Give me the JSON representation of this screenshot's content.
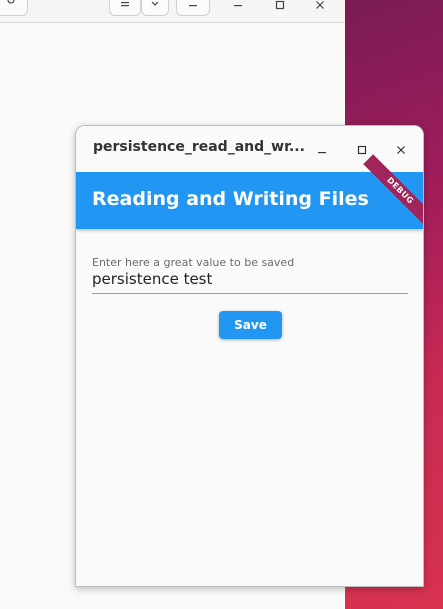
{
  "background_window": {
    "toolbar_icons": [
      "search-icon",
      "list-view-icon",
      "chevron-down-icon",
      "minimize-icon",
      "maximize-icon",
      "close-icon"
    ]
  },
  "app_window": {
    "title": "persistence_read_and_wr...",
    "controls": {
      "minimize": "–",
      "maximize": "☐",
      "close": "✕"
    }
  },
  "appbar": {
    "title": "Reading and Writing Files",
    "debug_banner": "DEBUG",
    "color": "#2196f3"
  },
  "form": {
    "label": "Enter here a great value to be saved",
    "value": "persistence test",
    "save_label": "Save"
  }
}
